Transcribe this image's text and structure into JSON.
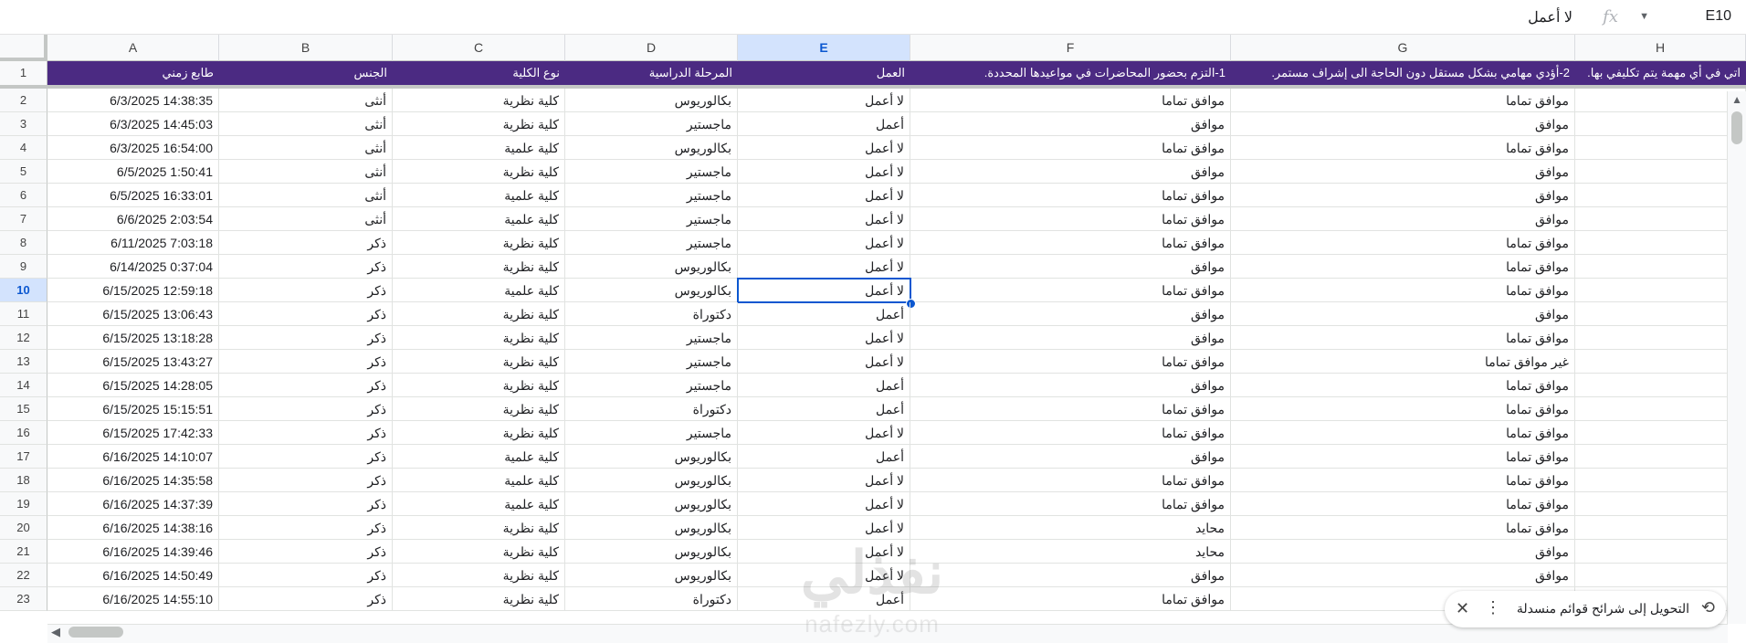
{
  "formula_bar": {
    "cell_ref": "E10",
    "fx_label": "fx",
    "value": "لا أعمل"
  },
  "columns": [
    {
      "letter": "A",
      "header": "طابع زمني"
    },
    {
      "letter": "B",
      "header": "الجنس"
    },
    {
      "letter": "C",
      "header": "نوع الكلية"
    },
    {
      "letter": "D",
      "header": "المرحلة الدراسية"
    },
    {
      "letter": "E",
      "header": "العمل"
    },
    {
      "letter": "F",
      "header": "1-التزم بحضور المحاضرات في مواعيدها المحددة."
    },
    {
      "letter": "G",
      "header": "2-أؤدي مهامي بشكل مستقل دون الحاجة الى إشراف مستمر."
    },
    {
      "letter": "H",
      "header": "اتي في أي مهمة يتم تكليفي بها."
    }
  ],
  "rows": [
    {
      "n": "2",
      "a": "6/3/2025 14:38:35",
      "b": "أنثى",
      "c": "كلية نظرية",
      "d": "بكالوريوس",
      "e": "لا أعمل",
      "f": "موافق تماما",
      "g": "موافق تماما"
    },
    {
      "n": "3",
      "a": "6/3/2025 14:45:03",
      "b": "أنثى",
      "c": "كلية نظرية",
      "d": "ماجستير",
      "e": "أعمل",
      "f": "موافق",
      "g": "موافق"
    },
    {
      "n": "4",
      "a": "6/3/2025 16:54:00",
      "b": "أنثى",
      "c": "كلية علمية",
      "d": "بكالوريوس",
      "e": "لا أعمل",
      "f": "موافق تماما",
      "g": "موافق تماما"
    },
    {
      "n": "5",
      "a": "6/5/2025 1:50:41",
      "b": "أنثى",
      "c": "كلية نظرية",
      "d": "ماجستير",
      "e": "لا أعمل",
      "f": "موافق",
      "g": "موافق"
    },
    {
      "n": "6",
      "a": "6/5/2025 16:33:01",
      "b": "أنثى",
      "c": "كلية علمية",
      "d": "ماجستير",
      "e": "لا أعمل",
      "f": "موافق تماما",
      "g": "موافق"
    },
    {
      "n": "7",
      "a": "6/6/2025 2:03:54",
      "b": "أنثى",
      "c": "كلية علمية",
      "d": "ماجستير",
      "e": "لا أعمل",
      "f": "موافق تماما",
      "g": "موافق"
    },
    {
      "n": "8",
      "a": "6/11/2025 7:03:18",
      "b": "ذكر",
      "c": "كلية نظرية",
      "d": "ماجستير",
      "e": "لا أعمل",
      "f": "موافق تماما",
      "g": "موافق تماما"
    },
    {
      "n": "9",
      "a": "6/14/2025 0:37:04",
      "b": "ذكر",
      "c": "كلية نظرية",
      "d": "بكالوريوس",
      "e": "لا أعمل",
      "f": "موافق",
      "g": "موافق تماما"
    },
    {
      "n": "10",
      "a": "6/15/2025 12:59:18",
      "b": "ذكر",
      "c": "كلية علمية",
      "d": "بكالوريوس",
      "e": "لا أعمل",
      "f": "موافق تماما",
      "g": "موافق تماما"
    },
    {
      "n": "11",
      "a": "6/15/2025 13:06:43",
      "b": "ذكر",
      "c": "كلية نظرية",
      "d": "دكتوراة",
      "e": "أعمل",
      "f": "موافق",
      "g": "موافق"
    },
    {
      "n": "12",
      "a": "6/15/2025 13:18:28",
      "b": "ذكر",
      "c": "كلية نظرية",
      "d": "ماجستير",
      "e": "لا أعمل",
      "f": "موافق",
      "g": "موافق تماما"
    },
    {
      "n": "13",
      "a": "6/15/2025 13:43:27",
      "b": "ذكر",
      "c": "كلية نظرية",
      "d": "ماجستير",
      "e": "لا أعمل",
      "f": "موافق تماما",
      "g": "غير موافق تماما"
    },
    {
      "n": "14",
      "a": "6/15/2025 14:28:05",
      "b": "ذكر",
      "c": "كلية نظرية",
      "d": "ماجستير",
      "e": "أعمل",
      "f": "موافق",
      "g": "موافق تماما"
    },
    {
      "n": "15",
      "a": "6/15/2025 15:15:51",
      "b": "ذكر",
      "c": "كلية نظرية",
      "d": "دكتوراة",
      "e": "أعمل",
      "f": "موافق تماما",
      "g": "موافق تماما"
    },
    {
      "n": "16",
      "a": "6/15/2025 17:42:33",
      "b": "ذكر",
      "c": "كلية نظرية",
      "d": "ماجستير",
      "e": "لا أعمل",
      "f": "موافق تماما",
      "g": "موافق تماما"
    },
    {
      "n": "17",
      "a": "6/16/2025 14:10:07",
      "b": "ذكر",
      "c": "كلية علمية",
      "d": "بكالوريوس",
      "e": "أعمل",
      "f": "موافق",
      "g": "موافق تماما"
    },
    {
      "n": "18",
      "a": "6/16/2025 14:35:58",
      "b": "ذكر",
      "c": "كلية علمية",
      "d": "بكالوريوس",
      "e": "لا أعمل",
      "f": "موافق تماما",
      "g": "موافق تماما"
    },
    {
      "n": "19",
      "a": "6/16/2025 14:37:39",
      "b": "ذكر",
      "c": "كلية علمية",
      "d": "بكالوريوس",
      "e": "لا أعمل",
      "f": "موافق تماما",
      "g": "موافق تماما"
    },
    {
      "n": "20",
      "a": "6/16/2025 14:38:16",
      "b": "ذكر",
      "c": "كلية نظرية",
      "d": "بكالوريوس",
      "e": "لا أعمل",
      "f": "محايد",
      "g": "موافق تماما"
    },
    {
      "n": "21",
      "a": "6/16/2025 14:39:46",
      "b": "ذكر",
      "c": "كلية نظرية",
      "d": "بكالوريوس",
      "e": "لا أعمل",
      "f": "محايد",
      "g": "موافق"
    },
    {
      "n": "22",
      "a": "6/16/2025 14:50:49",
      "b": "ذكر",
      "c": "كلية نظرية",
      "d": "بكالوريوس",
      "e": "لا أعمل",
      "f": "موافق",
      "g": "موافق"
    },
    {
      "n": "23",
      "a": "6/16/2025 14:55:10",
      "b": "ذكر",
      "c": "كلية نظرية",
      "d": "دكتوراة",
      "e": "أعمل",
      "f": "موافق تماما",
      "g": ""
    }
  ],
  "selected_cell": {
    "col": "E",
    "row": "10"
  },
  "toast": {
    "text": "التحويل إلى شرائح قوائم منسدلة",
    "close_icon": "close-icon",
    "more_icon": "more-vert-icon",
    "convert_icon": "convert-icon"
  },
  "watermark": {
    "logo": "نفذلي",
    "text": "nafezly.com"
  },
  "colors": {
    "header_band": "#4b2a82",
    "selection": "#0b57d0",
    "selected_header": "#d3e3fd"
  }
}
